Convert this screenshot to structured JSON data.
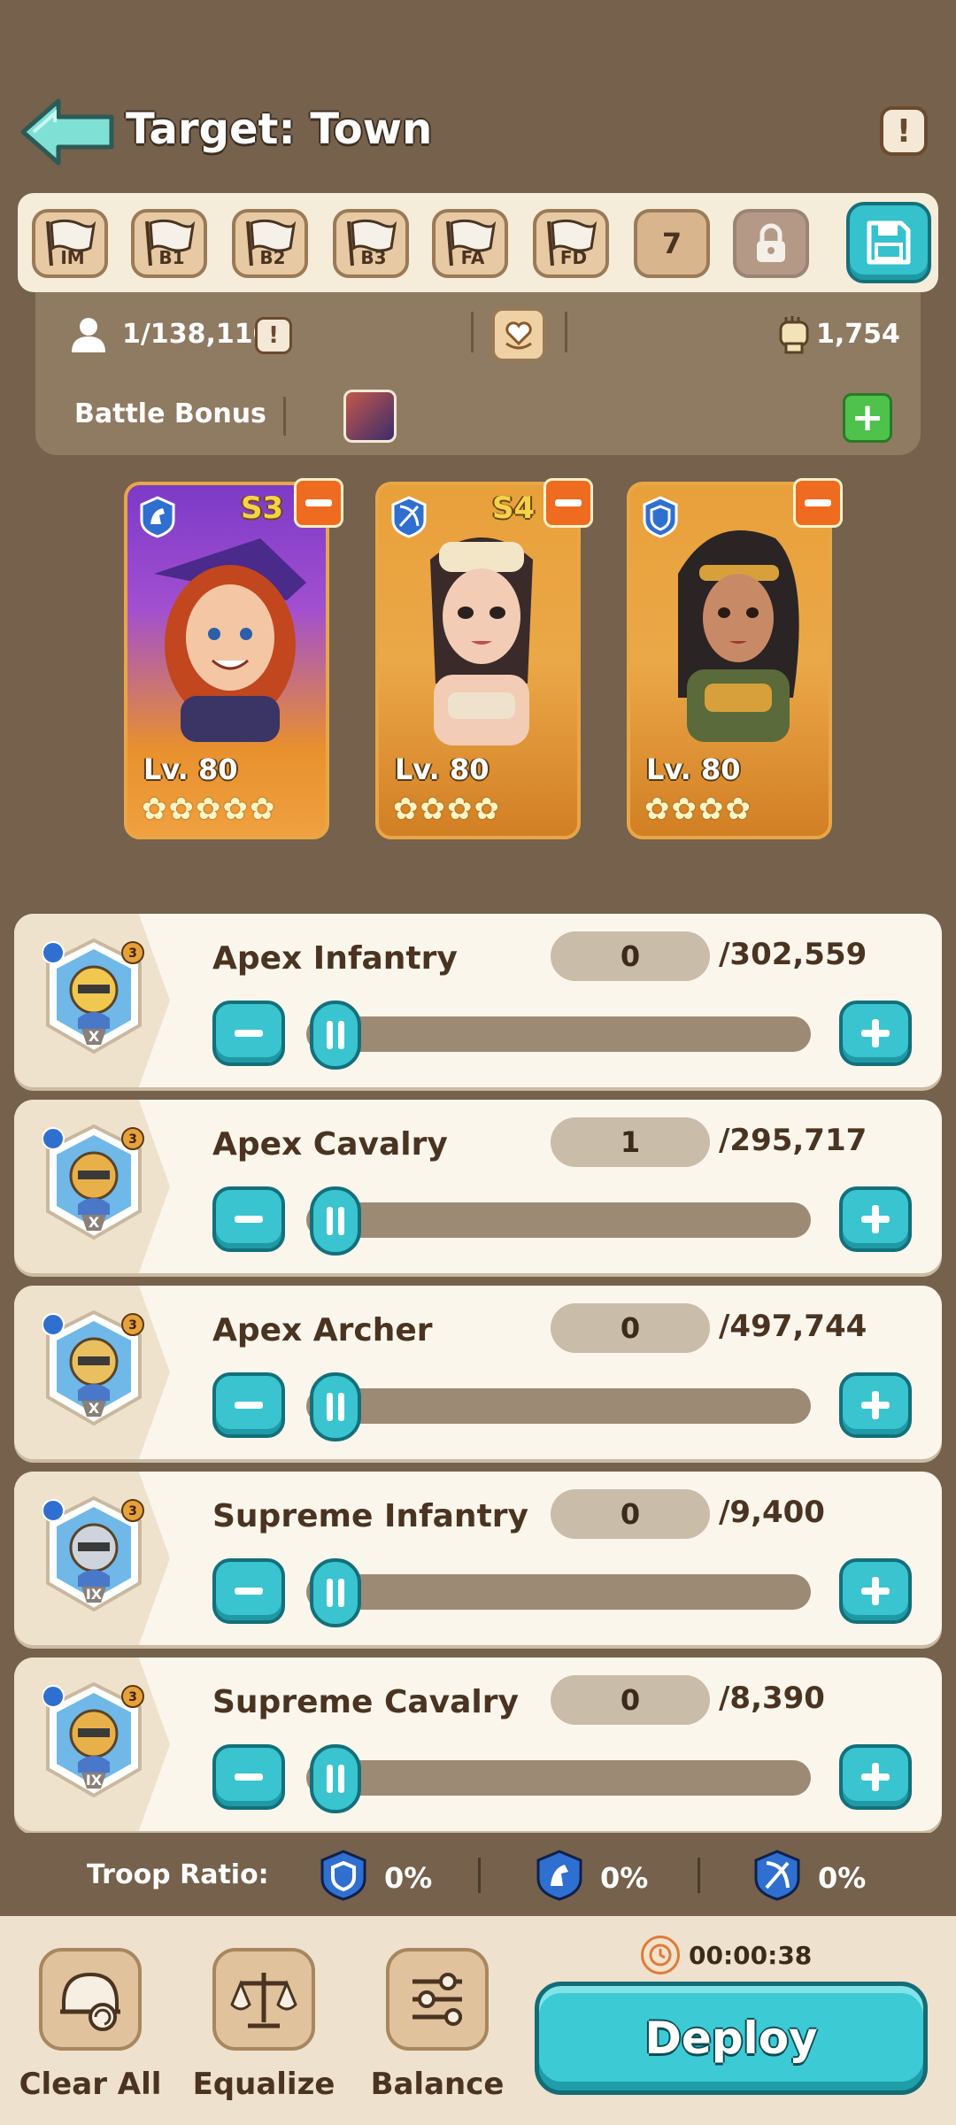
{
  "header": {
    "title": "Target: Town",
    "info_glyph": "!"
  },
  "formation": {
    "presets": [
      "IM",
      "B1",
      "B2",
      "B3",
      "FA",
      "FD"
    ],
    "number_slot": "7",
    "icons": [
      "flag-icon",
      "lock-icon",
      "save-icon"
    ]
  },
  "stats": {
    "rank": "1/138,110",
    "alert_glyph": "!",
    "power": "1,754"
  },
  "battle_bonus": {
    "label": "Battle Bonus",
    "add_glyph": "+"
  },
  "heroes": [
    {
      "level": "Lv. 80",
      "stars": "✿✿✿✿✿",
      "season": "S3",
      "class_icon": "cavalry-icon",
      "colors": [
        "#7c3ac7",
        "#e8902e"
      ]
    },
    {
      "level": "Lv. 80",
      "stars": "✿✿✿✿",
      "season": "S4",
      "class_icon": "archer-icon",
      "colors": [
        "#e8a03a",
        "#d27f24"
      ]
    },
    {
      "level": "Lv. 80",
      "stars": "✿✿✿✿",
      "season": "",
      "class_icon": "infantry-icon",
      "colors": [
        "#e8a03a",
        "#d27f24"
      ]
    }
  ],
  "troops": [
    {
      "name": "Apex Infantry",
      "count": "0",
      "max": "/302,559",
      "tier": "X",
      "class_icon": "infantry-icon",
      "fill": 0
    },
    {
      "name": "Apex Cavalry",
      "count": "1",
      "max": "/295,717",
      "tier": "X",
      "class_icon": "cavalry-icon",
      "fill": 0
    },
    {
      "name": "Apex Archer",
      "count": "0",
      "max": "/497,744",
      "tier": "X",
      "class_icon": "archer-icon",
      "fill": 0
    },
    {
      "name": "Supreme Infantry",
      "count": "0",
      "max": "/9,400",
      "tier": "IX",
      "class_icon": "infantry-icon",
      "fill": 0
    },
    {
      "name": "Supreme Cavalry",
      "count": "0",
      "max": "/8,390",
      "tier": "IX",
      "class_icon": "cavalry-icon",
      "fill": 0
    }
  ],
  "ratio": {
    "label": "Troop Ratio:",
    "infantry": "0%",
    "cavalry": "0%",
    "archer": "0%"
  },
  "tools": {
    "clear_all": "Clear All",
    "equalize": "Equalize",
    "balance": "Balance"
  },
  "deploy": {
    "timer": "00:00:38",
    "label": "Deploy"
  },
  "colors": {
    "background": "#75614c",
    "accent_teal": "#39c4cf",
    "remove_orange": "#ef6b1f",
    "add_green": "#4ec24a"
  }
}
